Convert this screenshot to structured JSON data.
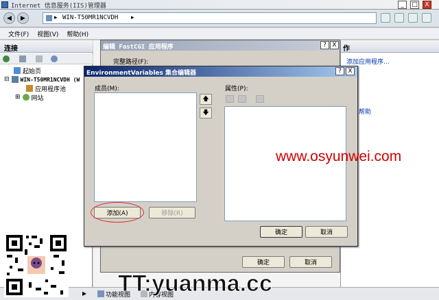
{
  "app": {
    "title": "Internet 信息服务(IIS)管理器",
    "window_buttons": [
      "_",
      "□",
      "X"
    ]
  },
  "address": {
    "path": "WIN-T50MR1NCVDH",
    "separator": "▸"
  },
  "menu": [
    "文件(F)",
    "视图(V)",
    "帮助(H)"
  ],
  "connections": {
    "title": "连接",
    "tree": [
      {
        "label": "起始页",
        "icon": "start-page-icon"
      },
      {
        "label": "WIN-T50MR1NCVDH (W",
        "icon": "server-icon"
      },
      {
        "label": "应用程序池",
        "icon": "app-pool-icon"
      },
      {
        "label": "网站",
        "icon": "sites-icon"
      }
    ]
  },
  "actions": {
    "title": "作",
    "items": [
      "添加应用程序...",
      "...",
      "助",
      "联机帮助"
    ]
  },
  "fastcgi_dialog": {
    "title": "编辑 FastCGI 应用程序",
    "full_path_label": "完整路径(F):",
    "ok_label": "确定",
    "cancel_label": "取消"
  },
  "env_dialog": {
    "title": "EnvironmentVariables 集合编辑器",
    "members_label": "成员(M):",
    "properties_label": "属性(P):",
    "add_label": "添加(A)",
    "remove_label": "移除(R)",
    "ok_label": "确定",
    "cancel_label": "取消",
    "help_button": "?",
    "close_button": "X"
  },
  "bottom_tabs": {
    "features_view": "功能视图",
    "content_view": "内容视图"
  },
  "watermarks": {
    "site": "www.osyunwei.com",
    "brand": "TT:yuanma.cc"
  },
  "colors": {
    "title_bar": "#0a246a",
    "title_bar_end": "#a6caf0",
    "window_bg": "#d4d0c8",
    "watermark_red": "#d00000",
    "highlight_oval": "#e03030"
  }
}
